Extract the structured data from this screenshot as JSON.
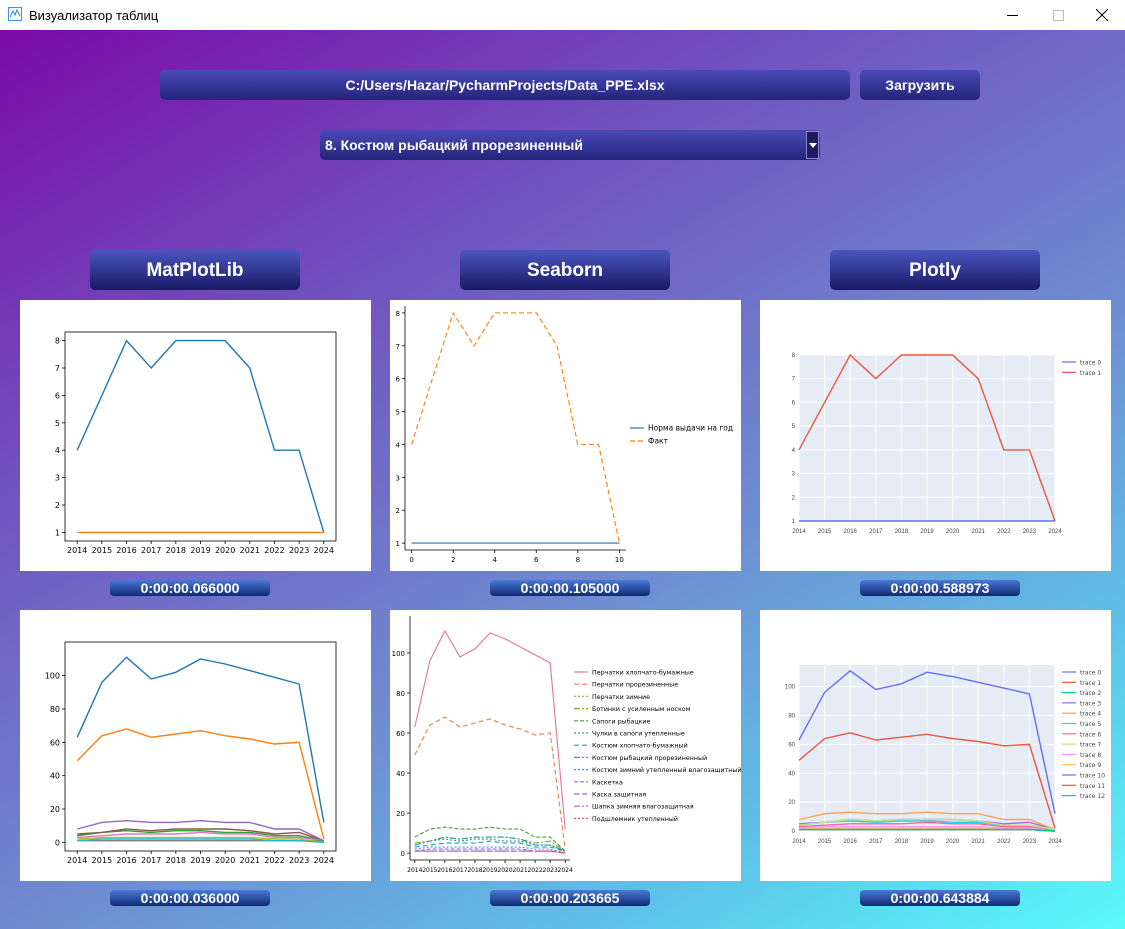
{
  "window": {
    "title": "Визуализатор таблиц"
  },
  "file_path": "C:/Users/Hazar/PycharmProjects/Data_PPE.xlsx",
  "load_button": "Загрузить",
  "selected_item": "8. Костюм рыбацкий прорезиненный",
  "libraries": [
    "MatPlotLib",
    "Seaborn",
    "Plotly"
  ],
  "timings": {
    "matplotlib_top": "0:00:00.066000",
    "seaborn_top": "0:00:00.105000",
    "plotly_top": "0:00:00.588973",
    "matplotlib_bottom": "0:00:00.036000",
    "seaborn_bottom": "0:00:00.203665",
    "plotly_bottom": "0:00:00.643884"
  },
  "chart_data": [
    {
      "id": "mpl_top",
      "type": "line",
      "x": [
        "2014",
        "2015",
        "2016",
        "2017",
        "2018",
        "2019",
        "2020",
        "2021",
        "2022",
        "2023",
        "2024"
      ],
      "ylim": [
        1,
        8
      ],
      "yticks": [
        "1",
        "2",
        "3",
        "4",
        "5",
        "6",
        "7",
        "8"
      ],
      "series": [
        {
          "values": [
            4,
            6,
            8,
            7,
            8,
            8,
            8,
            7,
            4,
            4,
            1
          ],
          "color": "#1f77b4"
        },
        {
          "values": [
            1,
            1,
            1,
            1,
            1,
            1,
            1,
            1,
            1,
            1,
            1
          ],
          "color": "#ff7f0e"
        }
      ]
    },
    {
      "id": "sns_top",
      "type": "line",
      "x": [
        "0",
        "1",
        "2",
        "3",
        "4",
        "5",
        "6",
        "7",
        "8",
        "9",
        "10"
      ],
      "xticks": [
        "0",
        "2",
        "4",
        "6",
        "8",
        "10"
      ],
      "yticks": [
        "1",
        "2",
        "3",
        "4",
        "5",
        "6",
        "7",
        "8"
      ],
      "ylim": [
        1,
        8
      ],
      "series": [
        {
          "name": "Норма выдачи на год",
          "values": [
            1,
            1,
            1,
            1,
            1,
            1,
            1,
            1,
            1,
            1,
            1
          ],
          "color": "#1f77b4",
          "dash": ""
        },
        {
          "name": "Факт",
          "values": [
            4,
            6,
            8,
            7,
            8,
            8,
            8,
            7,
            4,
            4,
            1
          ],
          "color": "#ff7f0e",
          "dash": "5,3"
        }
      ],
      "legend": "right"
    },
    {
      "id": "plotly_top",
      "type": "line",
      "x": [
        "2014",
        "2015",
        "2016",
        "2017",
        "2018",
        "2019",
        "2020",
        "2021",
        "2022",
        "2023",
        "2024"
      ],
      "yticks": [
        "1",
        "2",
        "3",
        "4",
        "5",
        "6",
        "7",
        "8"
      ],
      "ylim": [
        1,
        8
      ],
      "series": [
        {
          "name": "trace 0",
          "values": [
            1,
            1,
            1,
            1,
            1,
            1,
            1,
            1,
            1,
            1,
            1
          ],
          "color": "#636efa"
        },
        {
          "name": "trace 1",
          "values": [
            4,
            6,
            8,
            7,
            8,
            8,
            8,
            7,
            4,
            4,
            1
          ],
          "color": "#ef553b"
        }
      ],
      "legend": "top-right"
    },
    {
      "id": "mpl_bottom",
      "type": "line",
      "x": [
        "2014",
        "2015",
        "2016",
        "2017",
        "2018",
        "2019",
        "2020",
        "2021",
        "2022",
        "2023",
        "2024"
      ],
      "yticks": [
        "0",
        "20",
        "40",
        "60",
        "80",
        "100"
      ],
      "ylim": [
        0,
        115
      ],
      "series": [
        {
          "values": [
            63,
            96,
            111,
            98,
            102,
            110,
            107,
            103,
            99,
            95,
            12
          ],
          "color": "#1f77b4"
        },
        {
          "values": [
            49,
            64,
            68,
            63,
            65,
            67,
            64,
            62,
            59,
            60,
            2
          ],
          "color": "#ff7f0e"
        },
        {
          "values": [
            4,
            6,
            7,
            6,
            7,
            7,
            6,
            6,
            4,
            4,
            1
          ],
          "color": "#2ca02c"
        },
        {
          "values": [
            8,
            12,
            13,
            12,
            12,
            13,
            12,
            12,
            8,
            8,
            1
          ],
          "color": "#9467bd"
        },
        {
          "values": [
            5,
            6,
            8,
            7,
            8,
            8,
            8,
            7,
            5,
            6,
            1
          ],
          "color": "#8c564b"
        },
        {
          "values": [
            3,
            4,
            5,
            5,
            5,
            6,
            5,
            5,
            3,
            3,
            1
          ],
          "color": "#e377c2"
        },
        {
          "values": [
            1,
            1,
            1,
            1,
            1,
            1,
            1,
            1,
            1,
            1,
            1
          ],
          "color": "#7f7f7f"
        },
        {
          "values": [
            2,
            3,
            3,
            3,
            3,
            3,
            3,
            3,
            2,
            2,
            0
          ],
          "color": "#bcbd22"
        },
        {
          "values": [
            1,
            2,
            2,
            2,
            2,
            2,
            2,
            2,
            1,
            1,
            0
          ],
          "color": "#17becf"
        }
      ]
    },
    {
      "id": "sns_bottom",
      "type": "line",
      "x": [
        "2014",
        "2015",
        "2016",
        "2017",
        "2018",
        "2019",
        "2020",
        "2021",
        "2022",
        "2023",
        "2024"
      ],
      "yticks": [
        "0",
        "20",
        "40",
        "60",
        "80",
        "100"
      ],
      "ylim": [
        0,
        115
      ],
      "legend": "right",
      "series": [
        {
          "name": "Перчатки хлопчато-бумажные",
          "values": [
            63,
            96,
            111,
            98,
            102,
            110,
            107,
            103,
            99,
            95,
            12
          ],
          "color": "#e8739a",
          "dash": ""
        },
        {
          "name": "Перчатки прорезиненные",
          "values": [
            49,
            64,
            68,
            63,
            65,
            67,
            64,
            62,
            59,
            60,
            2
          ],
          "color": "#e8814a",
          "dash": "5,3"
        },
        {
          "name": "Перчатки зимние",
          "values": [
            1,
            1,
            1,
            1,
            1,
            1,
            1,
            1,
            1,
            1,
            1
          ],
          "color": "#c9a63a",
          "dash": "2,2"
        },
        {
          "name": "Ботинки с усиленным носком",
          "values": [
            5,
            6,
            8,
            7,
            8,
            8,
            8,
            7,
            5,
            6,
            1
          ],
          "color": "#8aa32a",
          "dash": "6,2,2,2"
        },
        {
          "name": "Сапоги рыбацкие",
          "values": [
            8,
            12,
            13,
            12,
            12,
            13,
            12,
            12,
            8,
            8,
            1
          ],
          "color": "#4aa030",
          "dash": "4,2"
        },
        {
          "name": "Чулки в сапоги утепленные",
          "values": [
            4,
            6,
            7,
            6,
            7,
            7,
            6,
            6,
            4,
            4,
            1
          ],
          "color": "#2ca070",
          "dash": "2,2"
        },
        {
          "name": "Костюм хлопчато-бумажный",
          "values": [
            3,
            4,
            5,
            5,
            5,
            6,
            5,
            5,
            3,
            3,
            1
          ],
          "color": "#2aa0a0",
          "dash": "5,3"
        },
        {
          "name": "Костюм рыбацкий прорезиненный",
          "values": [
            4,
            6,
            8,
            7,
            8,
            8,
            8,
            7,
            4,
            4,
            1
          ],
          "color": "#2a9ac8",
          "dash": "6,2,2,2"
        },
        {
          "name": "Костюм зимний утепленный влагозащитный",
          "values": [
            2,
            3,
            3,
            3,
            3,
            3,
            3,
            3,
            2,
            2,
            0
          ],
          "color": "#4a8ee0",
          "dash": "2,2"
        },
        {
          "name": "Каскетка",
          "values": [
            1,
            2,
            2,
            2,
            2,
            2,
            2,
            2,
            1,
            1,
            0
          ],
          "color": "#8a70e0",
          "dash": "4,2"
        },
        {
          "name": "Каска защитная",
          "values": [
            1,
            1,
            1,
            1,
            1,
            1,
            1,
            1,
            1,
            1,
            0
          ],
          "color": "#b05ad8",
          "dash": "5,3"
        },
        {
          "name": "Шапка зимняя влагозащитная",
          "values": [
            1,
            1,
            1,
            1,
            1,
            1,
            1,
            1,
            1,
            1,
            0
          ],
          "color": "#d04ac0",
          "dash": "6,2,2,2"
        },
        {
          "name": "Подшлемник утепленный",
          "values": [
            1,
            1,
            1,
            1,
            1,
            1,
            1,
            1,
            1,
            1,
            0
          ],
          "color": "#e0508a",
          "dash": "2,2"
        }
      ]
    },
    {
      "id": "plotly_bottom",
      "type": "line",
      "x": [
        "2014",
        "2015",
        "2016",
        "2017",
        "2018",
        "2019",
        "2020",
        "2021",
        "2022",
        "2023",
        "2024"
      ],
      "yticks": [
        "0",
        "20",
        "40",
        "60",
        "80",
        "100"
      ],
      "ylim": [
        0,
        115
      ],
      "legend": "top-right",
      "series": [
        {
          "name": "trace 0",
          "values": [
            63,
            96,
            111,
            98,
            102,
            110,
            107,
            103,
            99,
            95,
            12
          ],
          "color": "#636efa"
        },
        {
          "name": "trace 1",
          "values": [
            49,
            64,
            68,
            63,
            65,
            67,
            64,
            62,
            59,
            60,
            2
          ],
          "color": "#ef553b"
        },
        {
          "name": "trace 2",
          "values": [
            1,
            1,
            1,
            1,
            1,
            1,
            1,
            1,
            1,
            1,
            1
          ],
          "color": "#00cc96"
        },
        {
          "name": "trace 3",
          "values": [
            5,
            6,
            8,
            7,
            8,
            8,
            8,
            7,
            5,
            6,
            1
          ],
          "color": "#ab63fa"
        },
        {
          "name": "trace 4",
          "values": [
            8,
            12,
            13,
            12,
            12,
            13,
            12,
            12,
            8,
            8,
            1
          ],
          "color": "#ffa15a"
        },
        {
          "name": "trace 5",
          "values": [
            4,
            6,
            7,
            6,
            7,
            7,
            6,
            6,
            4,
            4,
            1
          ],
          "color": "#19d3f3"
        },
        {
          "name": "trace 6",
          "values": [
            3,
            4,
            5,
            5,
            5,
            6,
            5,
            5,
            3,
            3,
            1
          ],
          "color": "#ff6692"
        },
        {
          "name": "trace 7",
          "values": [
            4,
            6,
            8,
            7,
            8,
            8,
            8,
            7,
            4,
            4,
            1
          ],
          "color": "#b6e880"
        },
        {
          "name": "trace 8",
          "values": [
            2,
            3,
            3,
            3,
            3,
            3,
            3,
            3,
            2,
            2,
            0
          ],
          "color": "#ff97ff"
        },
        {
          "name": "trace 9",
          "values": [
            1,
            2,
            2,
            2,
            2,
            2,
            2,
            2,
            1,
            1,
            0
          ],
          "color": "#fecb52"
        },
        {
          "name": "trace 10",
          "values": [
            1,
            1,
            1,
            1,
            1,
            1,
            1,
            1,
            1,
            1,
            0
          ],
          "color": "#636efa"
        },
        {
          "name": "trace 11",
          "values": [
            1,
            1,
            1,
            1,
            1,
            1,
            1,
            1,
            1,
            1,
            0
          ],
          "color": "#ef553b"
        },
        {
          "name": "trace 12",
          "values": [
            1,
            1,
            1,
            1,
            1,
            1,
            1,
            1,
            1,
            1,
            0
          ],
          "color": "#00cc96"
        }
      ]
    }
  ]
}
